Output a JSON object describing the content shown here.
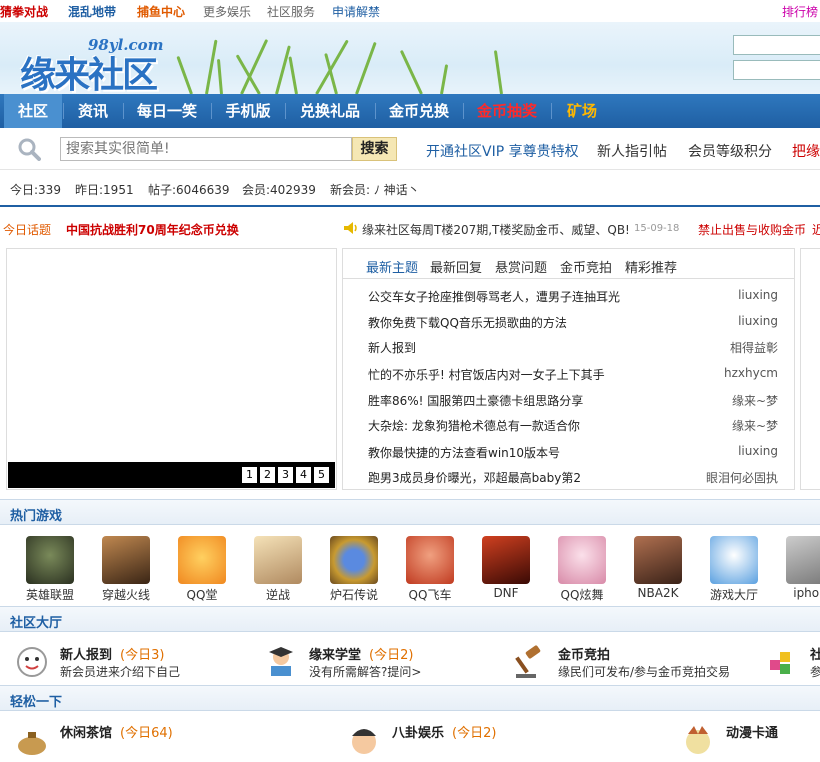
{
  "top_links": [
    {
      "label": "猜拳对战",
      "color": "#cc0000",
      "bold": true
    },
    {
      "label": "混乱地带",
      "color": "#1f5fa3",
      "bold": true
    },
    {
      "label": "捕鱼中心",
      "color": "#e05a00",
      "bold": true
    },
    {
      "label": "更多娱乐",
      "color": "#666666",
      "bold": false
    },
    {
      "label": "社区服务",
      "color": "#666666",
      "bold": false
    },
    {
      "label": "申请解禁",
      "color": "#1f5fa3",
      "bold": false
    },
    {
      "label": "排行榜",
      "color": "#cc00aa",
      "bold": false
    }
  ],
  "logo": {
    "main": "缘来社区",
    "sub": "98yl.com"
  },
  "nav": [
    "社区",
    "资讯",
    "每日一笑",
    "手机版",
    "兑换礼品",
    "金币兑换",
    "金币抽奖",
    "矿场"
  ],
  "nav_colors": {
    "lottery": "#ff2a2a",
    "mine": "#ffb800"
  },
  "search": {
    "placeholder": "搜索其实很简单!",
    "button": "搜索"
  },
  "search_links": [
    "开通社区VIP 享尊贵特权",
    "新人指引帖",
    "会员等级积分",
    "把缘"
  ],
  "stats": {
    "today": "今日:339",
    "yesterday": "昨日:1951",
    "posts": "帖子:6046639",
    "members": "会员:402939",
    "newest": "新会员: ﾉ 神话丶"
  },
  "ticker": {
    "label": "今日话题",
    "headline": "中国抗战胜利70周年纪念币兑换",
    "notice": "缘来社区每周T楼207期,T楼奖励金币、威望、QB!",
    "date": "15-09-18",
    "warning": "禁止出售与收购金币",
    "tail": "近"
  },
  "slide_pages": [
    "1",
    "2",
    "3",
    "4",
    "5"
  ],
  "tabs": [
    "最新主题",
    "最新回复",
    "悬赏问题",
    "金币竞拍",
    "精彩推荐"
  ],
  "topics": [
    {
      "title": "公交车女子抢座推倒辱骂老人，遭男子连抽耳光",
      "user": "liuxing"
    },
    {
      "title": "教你免费下载QQ音乐无损歌曲的方法",
      "user": "liuxing"
    },
    {
      "title": "新人报到",
      "user": "相得益彰"
    },
    {
      "title": "忙的不亦乐乎! 村官饭店内对一女子上下其手",
      "user": "hzxhycm"
    },
    {
      "title": "胜率86%! 国服第四土豪德卡组思路分享",
      "user": "缘来~梦"
    },
    {
      "title": "大杂烩: 龙象狗猎枪术德总有一款适合你",
      "user": "缘来~梦"
    },
    {
      "title": "教你最快捷的方法查看win10版本号",
      "user": "liuxing"
    },
    {
      "title": "跑男3成员身价曝光，邓超最高baby第2",
      "user": "眼泪何必固执"
    }
  ],
  "sections": {
    "games": "热门游戏",
    "hall": "社区大厅",
    "relax": "轻松一下"
  },
  "games": [
    {
      "label": "英雄联盟",
      "color": "#4a5a3a"
    },
    {
      "label": "穿越火线",
      "color": "#6b4a2a"
    },
    {
      "label": "QQ堂",
      "color": "#f0a030"
    },
    {
      "label": "逆战",
      "color": "#e8c890"
    },
    {
      "label": "炉石传说",
      "color": "#3a5a9a"
    },
    {
      "label": "QQ飞车",
      "color": "#d86040"
    },
    {
      "label": "DNF",
      "color": "#8a2a1a"
    },
    {
      "label": "QQ炫舞",
      "color": "#e8b0c0"
    },
    {
      "label": "NBA2K",
      "color": "#7a4a3a"
    },
    {
      "label": "游戏大厅",
      "color": "#3a8ad0"
    },
    {
      "label": "iphon",
      "color": "#888888"
    }
  ],
  "boards": [
    {
      "title": "新人报到",
      "count": "(今日3)",
      "desc": "新会员进来介绍下自己"
    },
    {
      "title": "缘来学堂",
      "count": "(今日2)",
      "desc": "没有所需解答?提问>"
    },
    {
      "title": "金币竞拍",
      "count": "",
      "desc": "缘民们可发布/参与金币竞拍交易"
    },
    {
      "title": "社",
      "count": "",
      "desc": "参"
    }
  ],
  "relax_boards": [
    {
      "title": "休闲茶馆",
      "count": "(今日64)"
    },
    {
      "title": "八卦娱乐",
      "count": "(今日2)"
    },
    {
      "title": "动漫卡通",
      "count": ""
    }
  ]
}
